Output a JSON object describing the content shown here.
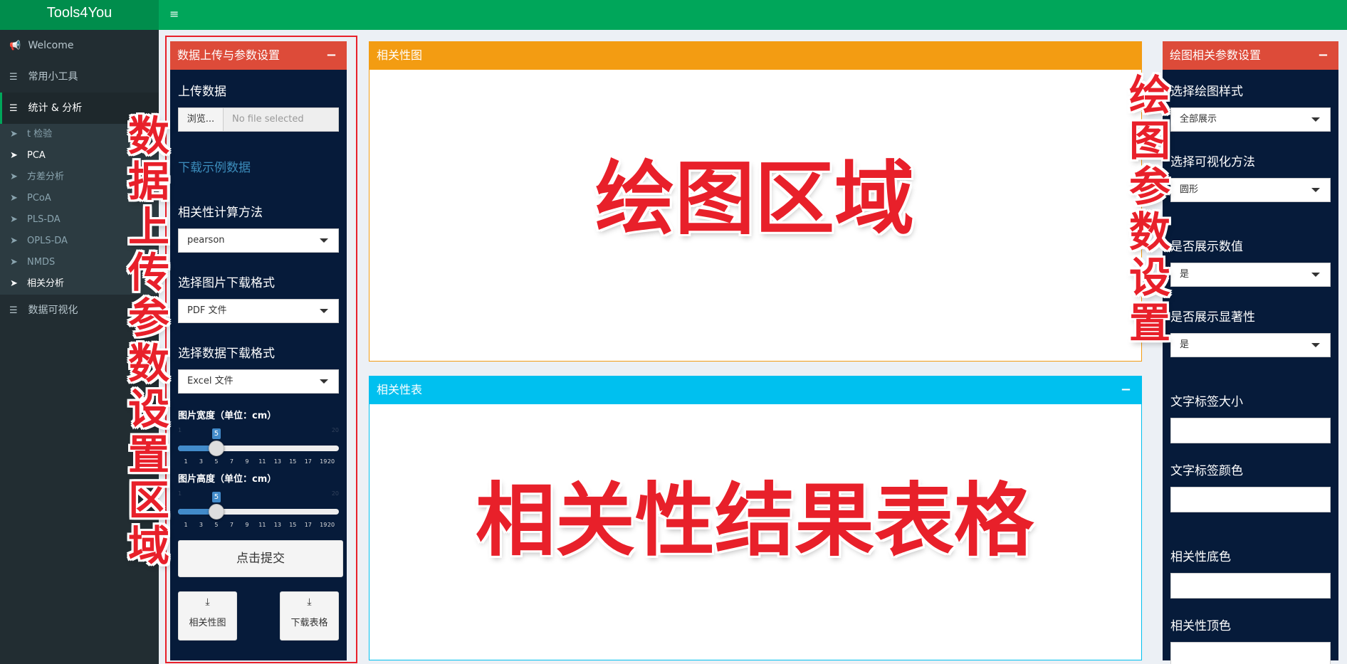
{
  "app": {
    "title": "Tools4You"
  },
  "topbar": {
    "menu_icon": "≡"
  },
  "sidebar": {
    "items": [
      {
        "label": "Welcome",
        "icon": "bullhorn-icon"
      },
      {
        "label": "常用小工具",
        "icon": "list-icon"
      },
      {
        "label": "统计 & 分析",
        "icon": "list-icon"
      },
      {
        "label": "数据可视化",
        "icon": "list-icon"
      }
    ],
    "subitems": [
      {
        "label": "t 检验"
      },
      {
        "label": "PCA"
      },
      {
        "label": "方差分析"
      },
      {
        "label": "PCoA"
      },
      {
        "label": "PLS-DA"
      },
      {
        "label": "OPLS-DA"
      },
      {
        "label": "NMDS"
      },
      {
        "label": "相关分析"
      }
    ]
  },
  "left_panel": {
    "title": "数据上传与参数设置",
    "collapse": "−",
    "upload_label": "上传数据",
    "browse_button": "浏览...",
    "file_status": "No file selected",
    "example_link": "下载示例数据",
    "method_label": "相关性计算方法",
    "method_value": "pearson",
    "img_format_label": "选择图片下载格式",
    "img_format_value": "PDF 文件",
    "data_format_label": "选择数据下载格式",
    "data_format_value": "Excel 文件",
    "width_slider": {
      "label": "图片宽度（单位：cm）",
      "min": "1",
      "max": "20",
      "value": "5",
      "ticks": [
        "1",
        "3",
        "5",
        "7",
        "9",
        "11",
        "13",
        "15",
        "17",
        "19",
        "20"
      ]
    },
    "height_slider": {
      "label": "图片高度（单位：cm）",
      "min": "1",
      "max": "20",
      "value": "5",
      "ticks": [
        "1",
        "3",
        "5",
        "7",
        "9",
        "11",
        "13",
        "15",
        "17",
        "19",
        "20"
      ]
    },
    "submit_button": "点击提交",
    "download_plot_button": "相关性图",
    "download_table_button": "下载表格"
  },
  "plot_panel": {
    "title": "相关性图"
  },
  "table_panel": {
    "title": "相关性表",
    "collapse": "−"
  },
  "right_panel": {
    "title": "绘图相关参数设置",
    "collapse": "−",
    "style_label": "选择绘图样式",
    "style_value": "全部展示",
    "method_label": "选择可视化方法",
    "method_value": "圆形",
    "show_values_label": "是否展示数值",
    "show_values_value": "是",
    "show_sig_label": "是否展示显著性",
    "show_sig_value": "是",
    "text_size_label": "文字标签大小",
    "text_color_label": "文字标签颜色",
    "bottom_color_label": "相关性底色",
    "top_color_label": "相关性顶色"
  },
  "annotations": {
    "left": "数据上传参数设置区域",
    "right": "绘图参数设置",
    "plot": "绘图区域",
    "table": "相关性结果表格"
  },
  "colors": {
    "header_green": "#00a65a",
    "logo_green": "#008d4c",
    "sidebar": "#222d32",
    "panel_dark": "#061b3a",
    "danger_red": "#dd4b39",
    "warning_orange": "#f39c12",
    "info_blue": "#00c0ef",
    "annotation_red": "#e8202a"
  }
}
